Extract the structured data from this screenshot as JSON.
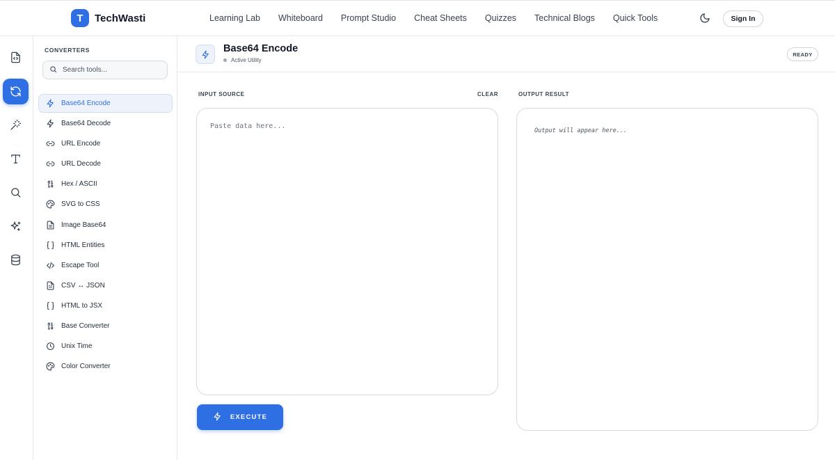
{
  "brand": {
    "logo_letter": "T",
    "name": "TechWasti"
  },
  "nav": [
    "Learning Lab",
    "Whiteboard",
    "Prompt Studio",
    "Cheat Sheets",
    "Quizzes",
    "Technical Blogs",
    "Quick Tools"
  ],
  "header_actions": {
    "theme_icon": "moon-icon",
    "sign_in": "Sign In"
  },
  "rail": [
    {
      "icon": "file-code-icon",
      "active": false
    },
    {
      "icon": "refresh-icon",
      "active": true
    },
    {
      "icon": "magic-wand-icon",
      "active": false
    },
    {
      "icon": "type-icon",
      "active": false
    },
    {
      "icon": "search-icon",
      "active": false
    },
    {
      "icon": "sparkles-icon",
      "active": false
    },
    {
      "icon": "database-icon",
      "active": false
    }
  ],
  "sidebar": {
    "heading": "CONVERTERS",
    "search_placeholder": "Search tools...",
    "tools": [
      {
        "label": "Base64 Encode",
        "icon": "bolt-icon",
        "active": true
      },
      {
        "label": "Base64 Decode",
        "icon": "bolt-icon",
        "active": false
      },
      {
        "label": "URL Encode",
        "icon": "link-icon",
        "active": false
      },
      {
        "label": "URL Decode",
        "icon": "link-icon",
        "active": false
      },
      {
        "label": "Hex / ASCII",
        "icon": "binary-icon",
        "active": false
      },
      {
        "label": "SVG to CSS",
        "icon": "palette-icon",
        "active": false
      },
      {
        "label": "Image Base64",
        "icon": "file-icon",
        "active": false
      },
      {
        "label": "HTML Entities",
        "icon": "braces-icon",
        "active": false
      },
      {
        "label": "Escape Tool",
        "icon": "code-icon",
        "active": false
      },
      {
        "label": "CSV ↔ JSON",
        "icon": "file-text-icon",
        "active": false
      },
      {
        "label": "HTML to JSX",
        "icon": "braces-icon",
        "active": false
      },
      {
        "label": "Base Converter",
        "icon": "binary-icon",
        "active": false
      },
      {
        "label": "Unix Time",
        "icon": "clock-icon",
        "active": false
      },
      {
        "label": "Color Converter",
        "icon": "palette-icon",
        "active": false
      }
    ]
  },
  "main": {
    "title": "Base64 Encode",
    "status": "Active Utility",
    "badge": "READY",
    "input_label": "INPUT SOURCE",
    "clear_label": "CLEAR",
    "input_placeholder": "Paste data here...",
    "output_label": "OUTPUT RESULT",
    "output_placeholder": "Output will appear here...",
    "execute_label": "EXECUTE"
  },
  "colors": {
    "accent": "#2f6fe4",
    "accent_soft": "#eef3fb",
    "border": "#e5e7eb"
  }
}
